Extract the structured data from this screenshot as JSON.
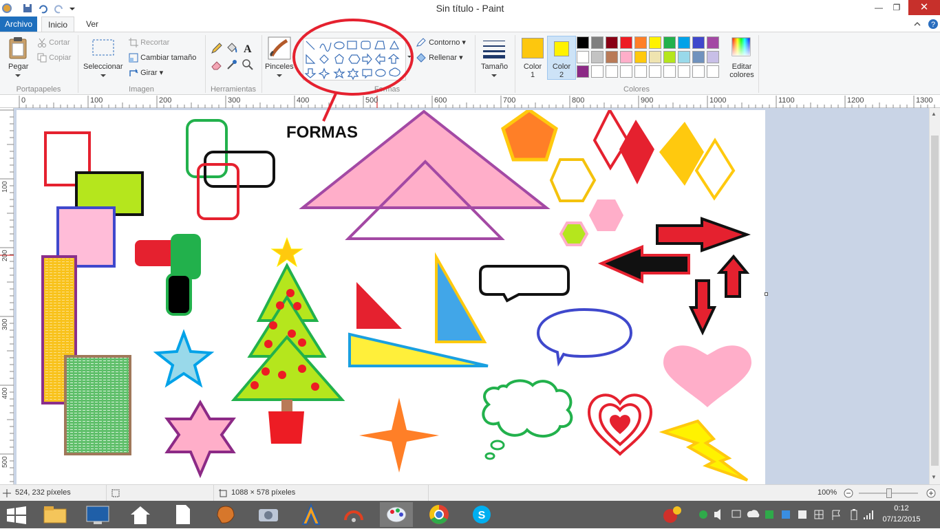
{
  "window": {
    "title": "Sin título - Paint",
    "controls": {
      "minimize": "—",
      "maximize": "❐",
      "close": "✕"
    }
  },
  "tabs": [
    "Archivo",
    "Inicio",
    "Ver"
  ],
  "ribbon": {
    "portapapeles": {
      "label": "Portapapeles",
      "pegar": "Pegar",
      "cortar": "Cortar",
      "copiar": "Copiar"
    },
    "imagen": {
      "label": "Imagen",
      "seleccionar": "Seleccionar",
      "recortar": "Recortar",
      "cambiar_tamano": "Cambiar tamaño",
      "girar": "Girar"
    },
    "herramientas": {
      "label": "Herramientas"
    },
    "pinceles": "Pinceles",
    "formas": {
      "label": "Formas",
      "contorno": "Contorno",
      "rellenar": "Rellenar"
    },
    "tamano": "Tamaño",
    "colores": {
      "label": "Colores",
      "color1": "Color\n1",
      "color2": "Color\n2",
      "color1_value": "#fdc70e",
      "color2_value": "#fff200",
      "editar": "Editar\ncolores",
      "palette_row1": [
        "#000000",
        "#7f7f7f",
        "#880015",
        "#ed1c24",
        "#ff7f27",
        "#fff200",
        "#22b14c",
        "#00a2e8",
        "#3f48cc",
        "#a349a4"
      ],
      "palette_row2": [
        "#ffffff",
        "#c3c3c3",
        "#b97a57",
        "#ffaec9",
        "#ffc90e",
        "#efe4b0",
        "#b5e61d",
        "#99d9ea",
        "#7092be",
        "#c8bfe7"
      ],
      "palette_row3": [
        "#8c2a86",
        "#ffffff",
        "#ffffff",
        "#ffffff",
        "#ffffff",
        "#ffffff",
        "#ffffff",
        "#ffffff",
        "#ffffff",
        "#ffffff"
      ]
    }
  },
  "ruler_top": [
    "0",
    "100",
    "200",
    "300",
    "400",
    "500",
    "600",
    "700",
    "800",
    "900",
    "1000",
    "1100",
    "1200",
    "1300"
  ],
  "ruler_left": [
    "100",
    "200",
    "300",
    "400",
    "500"
  ],
  "annotation": "FORMAS",
  "status": {
    "position": "524, 232 píxeles",
    "size": "1088 × 578 píxeles",
    "zoom": "100%"
  },
  "taskbar": {
    "time": "0:12",
    "date": "07/12/2015"
  }
}
